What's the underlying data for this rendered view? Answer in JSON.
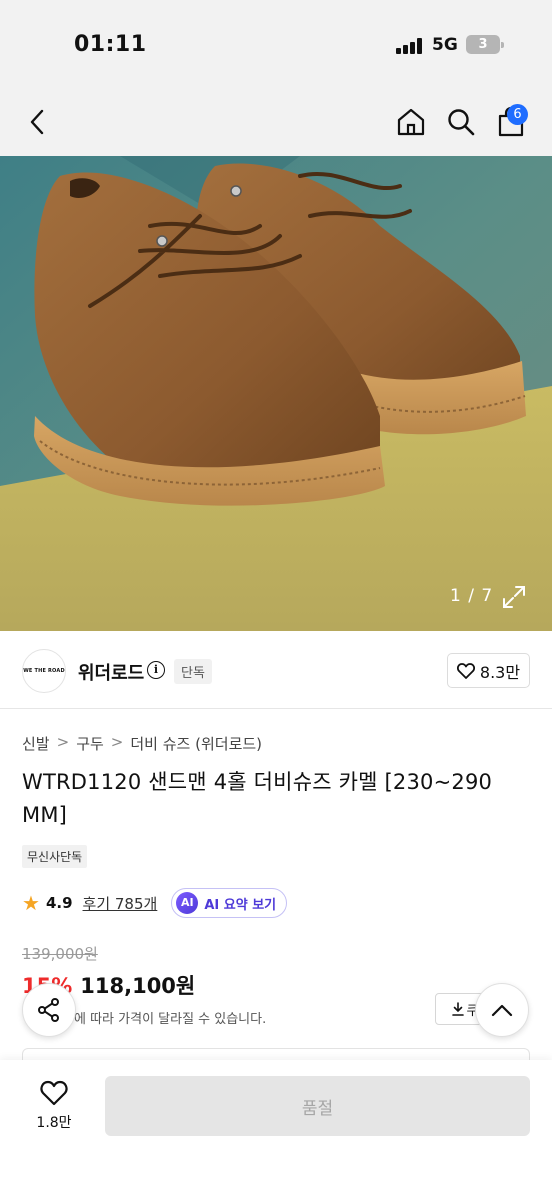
{
  "status_bar": {
    "time": "01:11",
    "network": "5G",
    "battery": "3"
  },
  "header": {
    "cart_count": "6"
  },
  "gallery": {
    "counter": "1 / 7"
  },
  "brand": {
    "logo_text": "WE THE ROAD",
    "name": "위더로드",
    "badge": "단독",
    "likes": "8.3만"
  },
  "breadcrumb": [
    "신발",
    "구두",
    "더비 슈즈 (위더로드)"
  ],
  "product": {
    "title": "WTRD1120 샌드맨 4홀 더비슈즈 카멜 [230~290 MM]",
    "tag": "무신사단독",
    "rating": "4.9",
    "reviews": "후기 785개",
    "ai_label": "AI",
    "ai_text": "AI 요약 보기",
    "original_price": "139,000원",
    "discount": "15%",
    "sale_price": "118,100원",
    "price_note": "에 따라 가격이 달라질 수 있습니다.",
    "coupon_label": "쿠"
  },
  "bottom": {
    "wish_count": "1.8만",
    "soldout": "품절"
  },
  "colors": {
    "accent": "#1f6dff",
    "discount": "#ee2b2b",
    "ai": "#4e3ad8",
    "star": "#f5a524"
  }
}
